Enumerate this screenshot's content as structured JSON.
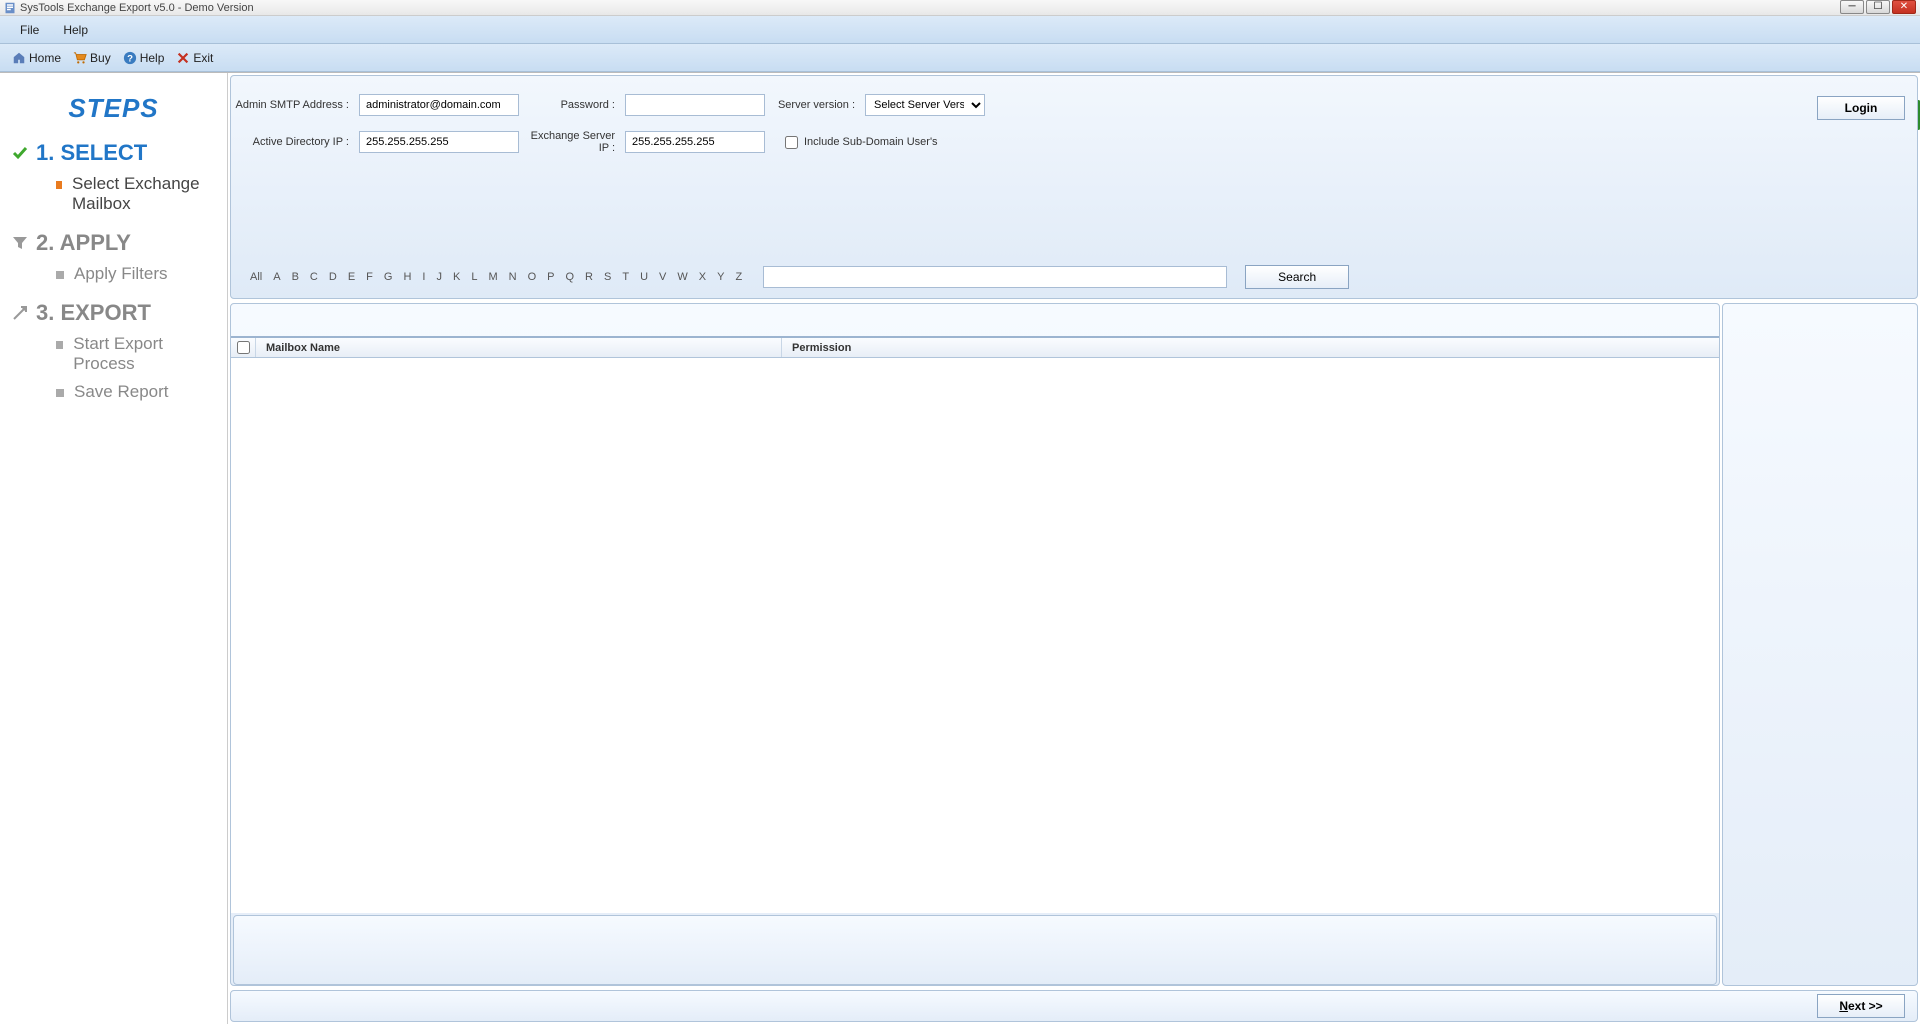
{
  "window": {
    "title": "SysTools Exchange Export v5.0 - Demo Version"
  },
  "menubar": {
    "file": "File",
    "help": "Help"
  },
  "toolbar": {
    "home": "Home",
    "buy": "Buy",
    "help": "Help",
    "exit": "Exit"
  },
  "sidebar": {
    "heading": "STEPS",
    "step1": {
      "title": "1. SELECT",
      "sub": "Select Exchange Mailbox"
    },
    "step2": {
      "title": "2. APPLY",
      "sub": "Apply Filters"
    },
    "step3": {
      "title": "3. EXPORT",
      "sub1": "Start Export Process",
      "sub2": "Save Report"
    }
  },
  "form": {
    "smtp_label": "Admin SMTP Address :",
    "smtp_value": "administrator@domain.com",
    "password_label": "Password :",
    "password_value": "",
    "serverver_label": "Server version :",
    "serverver_selected": "Select Server Version",
    "ad_label": "Active Directory IP :",
    "ad_value": "255.255.255.255",
    "exch_label": "Exchange Server IP :",
    "exch_value": "255.255.255.255",
    "subdomain_label": "Include Sub-Domain User's",
    "login_label": "Login"
  },
  "filter": {
    "alpha": [
      "All",
      "A",
      "B",
      "C",
      "D",
      "E",
      "F",
      "G",
      "H",
      "I",
      "J",
      "K",
      "L",
      "M",
      "N",
      "O",
      "P",
      "Q",
      "R",
      "S",
      "T",
      "U",
      "V",
      "W",
      "X",
      "Y",
      "Z"
    ],
    "search_label": "Search"
  },
  "table": {
    "col_mailbox": "Mailbox Name",
    "col_permission": "Permission"
  },
  "footer": {
    "next_n": "N",
    "next_rest": "ext >>"
  }
}
